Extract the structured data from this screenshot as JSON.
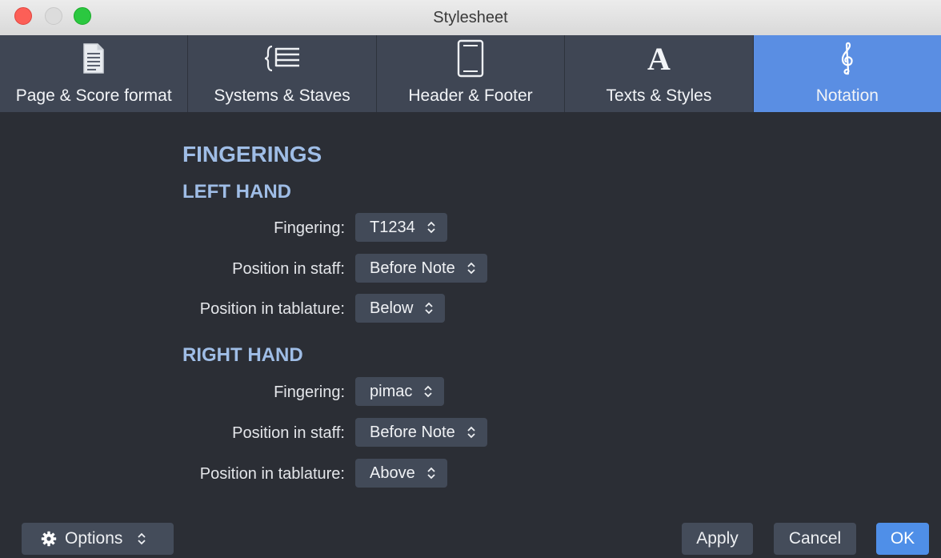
{
  "window": {
    "title": "Stylesheet"
  },
  "tabs": [
    {
      "label": "Page & Score format",
      "icon": "page-icon",
      "active": false
    },
    {
      "label": "Systems & Staves",
      "icon": "systems-icon",
      "active": false
    },
    {
      "label": "Header & Footer",
      "icon": "header-footer-icon",
      "active": false
    },
    {
      "label": "Texts & Styles",
      "icon": "text-style-icon",
      "active": false
    },
    {
      "label": "Notation",
      "icon": "treble-clef-icon",
      "active": true
    }
  ],
  "content": {
    "section_title": "FINGERINGS",
    "left_hand": {
      "title": "LEFT HAND",
      "fingering_label": "Fingering:",
      "fingering_value": "T1234",
      "staff_label": "Position in staff:",
      "staff_value": "Before Note",
      "tab_label": "Position in tablature:",
      "tab_value": "Below"
    },
    "right_hand": {
      "title": "RIGHT HAND",
      "fingering_label": "Fingering:",
      "fingering_value": "pimac",
      "staff_label": "Position in staff:",
      "staff_value": "Before Note",
      "tab_label": "Position in tablature:",
      "tab_value": "Above"
    }
  },
  "footer": {
    "options_label": "Options",
    "apply_label": "Apply",
    "cancel_label": "Cancel",
    "ok_label": "OK"
  },
  "colors": {
    "accent": "#5a8ee3",
    "heading": "#9fbde6",
    "background": "#2b2e35",
    "toolbar": "#3f4654"
  }
}
